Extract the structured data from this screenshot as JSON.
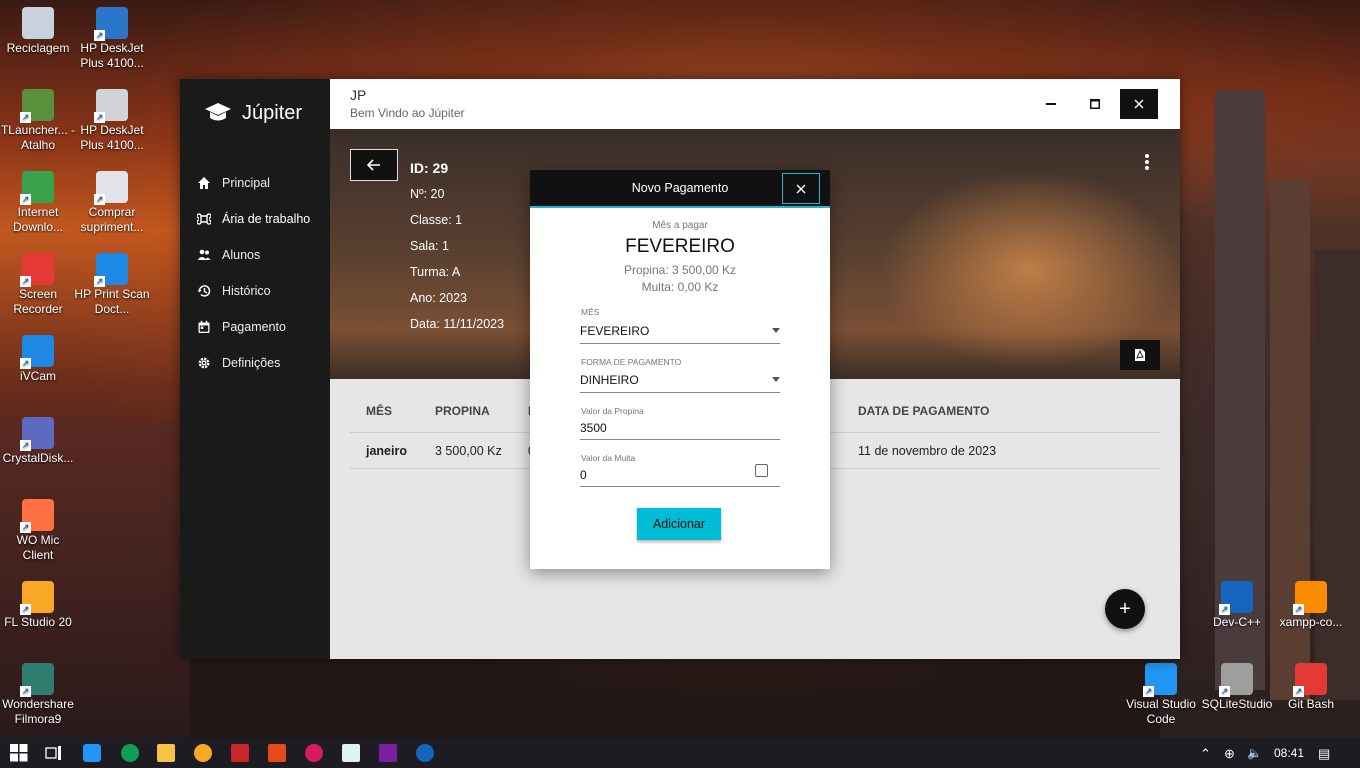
{
  "desktop": {
    "icons": [
      {
        "label": "Reciclagem",
        "color": "#c7d2dc"
      },
      {
        "label": "HP DeskJet Plus 4100...",
        "color": "#2a77c9"
      },
      {
        "label": "TLauncher... - Atalho",
        "color": "#5a8f3c"
      },
      {
        "label": "HP DeskJet Plus 4100...",
        "color": "#d0d4d8"
      },
      {
        "label": "Internet Downlo...",
        "color": "#3aa24a"
      },
      {
        "label": "Comprar supriment...",
        "color": "#e0e4ea"
      },
      {
        "label": "Screen Recorder",
        "color": "#e53935"
      },
      {
        "label": "HP Print Scan Doct...",
        "color": "#1e88e5"
      },
      {
        "label": "iVCam",
        "color": "#1e88e5"
      },
      {
        "label": "CrystalDisk...",
        "color": "#5c6bc0"
      },
      {
        "label": "WO Mic Client",
        "color": "#ff7043"
      },
      {
        "label": "FL Studio 20",
        "color": "#f9a825"
      },
      {
        "label": "Wondershare Filmora9",
        "color": "#2e7d6f"
      },
      {
        "label": "Dev-C++",
        "color": "#1565c0"
      },
      {
        "label": "xampp-co...",
        "color": "#fb8c00"
      },
      {
        "label": "Visual Studio Code",
        "color": "#2196f3"
      },
      {
        "label": "SQLiteStudio",
        "color": "#9e9e9e"
      },
      {
        "label": "Git Bash",
        "color": "#e53935"
      }
    ]
  },
  "app": {
    "brand": "Júpiter",
    "window_title": "JP",
    "window_subtitle": "Bem Vindo ao  Júpiter",
    "nav": [
      {
        "label": "Principal",
        "icon": "home-icon"
      },
      {
        "label": "Ária de trabalho",
        "icon": "command-icon"
      },
      {
        "label": "Alunos",
        "icon": "people-icon"
      },
      {
        "label": "Histórico",
        "icon": "history-icon"
      },
      {
        "label": "Pagamento",
        "icon": "calendar-icon"
      },
      {
        "label": "Definições",
        "icon": "gear-icon"
      }
    ],
    "student": {
      "id": "ID: 29",
      "numero": "Nº: 20",
      "classe": "Classe: 1",
      "sala": "Sala: 1",
      "turma": "Turma: A",
      "ano": "Ano: 2023",
      "data": "Data: 11/11/2023"
    },
    "table": {
      "headers": [
        "MÊS",
        "PROPINA",
        "M",
        "DATA DE PAGAMENTO"
      ],
      "rows": [
        {
          "mes": "janeiro",
          "propina": "3 500,00 Kz",
          "multa": "0",
          "data": "11 de novembro de 2023"
        }
      ]
    },
    "fab_label": "+"
  },
  "modal": {
    "title": "Novo Pagamento",
    "mes_a_pagar_label": "Mês a pagar",
    "mes_a_pagar": "FEVEREIRO",
    "propina_info": "Propina: 3 500,00 Kz",
    "multa_info": "Multa: 0,00 Kz",
    "mes_field_label": "Mês",
    "mes_field_value": "FEVEREIRO",
    "forma_label": "Forma de pagamento",
    "forma_value": "DINHEIRO",
    "valor_propina_label": "Valor da Propina",
    "valor_propina_value": "3500",
    "valor_multa_label": "Valor da Multa",
    "valor_multa_value": "0",
    "add_label": "Adicionar",
    "accent_color": "#00bcd4"
  },
  "taskbar": {
    "time": "08:41"
  }
}
